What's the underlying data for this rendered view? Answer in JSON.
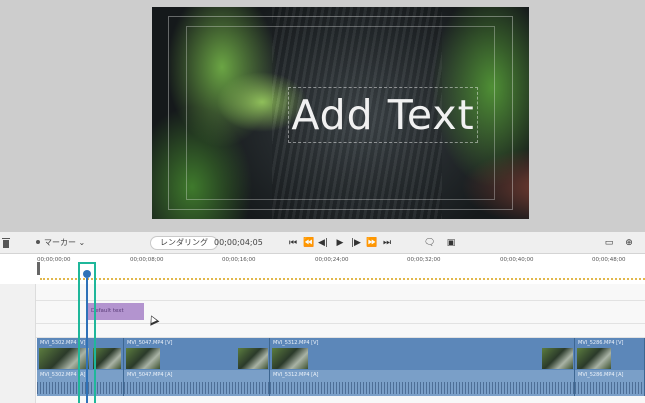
{
  "preview": {
    "overlay_text": "Add Text"
  },
  "toolbar": {
    "marker_label": "マーカー",
    "marker_chevron": "⌄",
    "render_label": "レンダリング",
    "current_time": "00;00;04;05",
    "icons": {
      "to_start": "⏮",
      "prev_frame": "⏪",
      "step_back": "◀|",
      "play": "▶",
      "step_fwd": "|▶",
      "next_frame": "⏩",
      "to_end": "⏭",
      "comment": "🗨",
      "snapshot": "▣",
      "monitor": "▭",
      "zoom": "⊕"
    }
  },
  "ruler": {
    "timecodes": [
      "00;00;00;00",
      "00;00;08;00",
      "00;00;16;00",
      "00;00;24;00",
      "00;00;32;00",
      "00;00;40;00",
      "00;00;48;00"
    ]
  },
  "timeline": {
    "title_clip_label": "Default text",
    "video_clips": [
      "MVI_5302.MP4 [V]",
      "MVI_5047.MP4 [V]",
      "MVI_5312.MP4 [V]",
      "MVI_5286.MP4 [V]"
    ],
    "audio_clips": [
      "MVI_5302.MP4 [A]",
      "MVI_5047.MP4 [A]",
      "MVI_5312.MP4 [A]",
      "MVI_5286.MP4 [A]"
    ]
  },
  "colors": {
    "playhead_box": "#1fb79a",
    "playhead": "#2f72b8",
    "title_clip": "#b394cf",
    "video_clip": "#5c87b9",
    "audio_clip": "#7a9fc8",
    "ruler_dots": "#e1b74b"
  }
}
